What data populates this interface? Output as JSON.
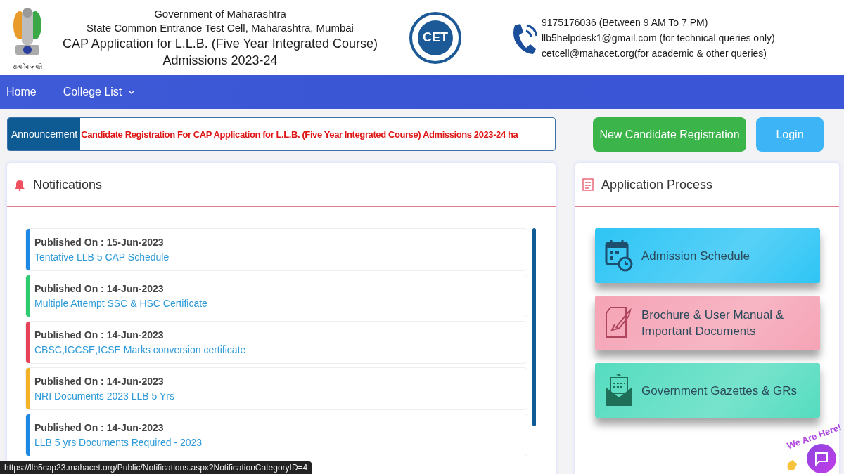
{
  "header": {
    "emblem_motto": "सत्यमेव जयते",
    "lines": [
      "Government of Maharashtra",
      "State Common Entrance Test Cell, Maharashtra, Mumbai"
    ],
    "title_lines": [
      "CAP Application for L.L.B. (Five Year Integrated Course)",
      "Admissions 2023-24"
    ],
    "logo_text": "CET",
    "contacts": [
      "9175176036 (Between 9 AM To 7 PM)",
      "llb5helpdesk1@gmail.com (for technical queries only)",
      "cetcell@mahacet.org(for academic & other queries)"
    ]
  },
  "nav": [
    {
      "label": "Home",
      "dropdown": false
    },
    {
      "label": "College List",
      "dropdown": true
    }
  ],
  "announcement": {
    "label": "Announcement",
    "text": "Candidate Registration For CAP Application for L.L.B. (Five Year Integrated Course) Admissions 2023-24 ha"
  },
  "buttons": [
    {
      "label": "New Candidate Registration",
      "kind": "primary"
    },
    {
      "label": "Login",
      "kind": "secondary"
    }
  ],
  "notifications": {
    "title": "Notifications",
    "items": [
      {
        "published": "Published On : 15-Jun-2023",
        "link": "Tentative LLB 5 CAP Schedule",
        "color": "#1e88e5"
      },
      {
        "published": "Published On : 14-Jun-2023",
        "link": "Multiple Attempt SSC & HSC Certificate",
        "color": "#2ecc71"
      },
      {
        "published": "Published On : 14-Jun-2023",
        "link": "CBSC,IGCSE,ICSE Marks conversion certificate",
        "color": "#e8415a"
      },
      {
        "published": "Published On : 14-Jun-2023",
        "link": "NRI Documents 2023 LLB 5 Yrs",
        "color": "#f5b225"
      },
      {
        "published": "Published On : 14-Jun-2023",
        "link": "LLB 5 yrs Documents Required - 2023",
        "color": "#1e88e5"
      }
    ]
  },
  "application_process": {
    "title": "Application Process",
    "cards": [
      {
        "label": "Admission Schedule",
        "kind": "calendar",
        "color": "#2ec5f5"
      },
      {
        "label": "Brochure & User Manual & Important Documents",
        "kind": "document",
        "color": "#f5a3b5"
      },
      {
        "label": "Government Gazettes & GRs",
        "kind": "mail",
        "color": "#55dcc0"
      }
    ]
  },
  "chat_widget": {
    "caption": "We Are Here!"
  },
  "status_url": "https://llb5cap23.mahacet.org/Public/Notifications.aspx?NotificationCategoryID=4"
}
